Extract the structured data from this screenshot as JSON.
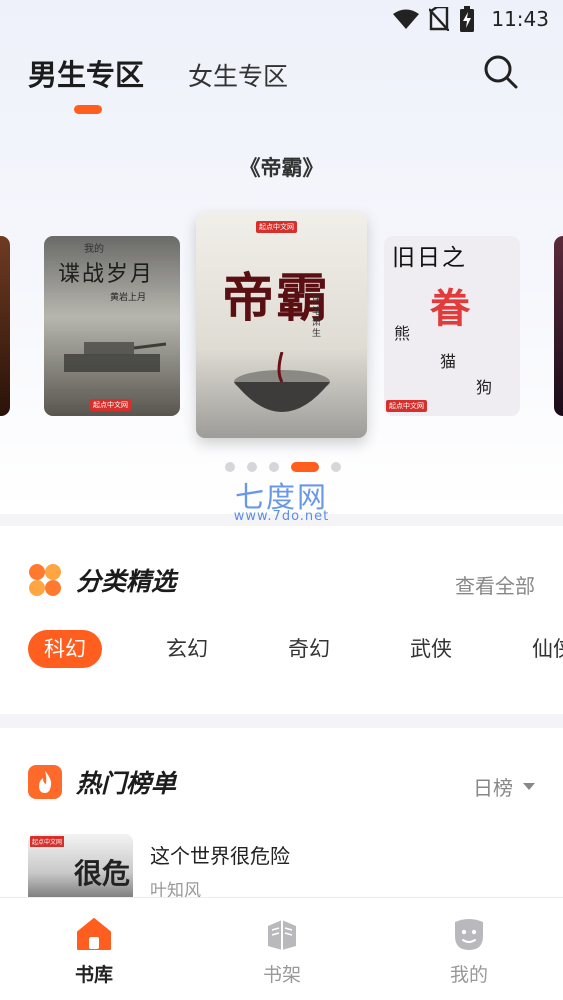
{
  "status_bar": {
    "time": "11:43"
  },
  "header": {
    "tabs": [
      {
        "label": "男生专区",
        "active": true
      },
      {
        "label": "女生专区",
        "active": false
      }
    ]
  },
  "featured": {
    "title": "《帝霸》",
    "active_index": 3,
    "covers": [
      {
        "title": "谍战岁月",
        "subtitle": "我的",
        "author": "黄岩上月",
        "publisher": "起点中文网"
      },
      {
        "title": "帝霸",
        "author": "厌笔萧生",
        "publisher": "起点中文网"
      },
      {
        "title": "旧日之",
        "big": "眷",
        "lines": [
          "熊",
          "猫",
          "狗"
        ],
        "publisher": "起点中文网"
      }
    ],
    "dot_count": 5
  },
  "watermark": {
    "cn": "七度网",
    "en": "www.7do.net"
  },
  "categories": {
    "title": "分类精选",
    "view_all": "查看全部",
    "items": [
      {
        "label": "科幻",
        "active": true
      },
      {
        "label": "玄幻",
        "active": false
      },
      {
        "label": "奇幻",
        "active": false
      },
      {
        "label": "武侠",
        "active": false
      },
      {
        "label": "仙侠",
        "active": false
      }
    ]
  },
  "hot_list": {
    "title": "热门榜单",
    "filter": "日榜",
    "books": [
      {
        "title": "这个世界很危险",
        "author": "叶知风",
        "cover_text": "很危",
        "publisher": "起点中文网"
      }
    ]
  },
  "bottom_nav": [
    {
      "label": "书库",
      "icon": "home-icon",
      "active": true
    },
    {
      "label": "书架",
      "icon": "bookshelf-icon",
      "active": false
    },
    {
      "label": "我的",
      "icon": "profile-icon",
      "active": false
    }
  ],
  "colors": {
    "accent": "#ff5e1f",
    "watermark": "#5a8ee6"
  }
}
